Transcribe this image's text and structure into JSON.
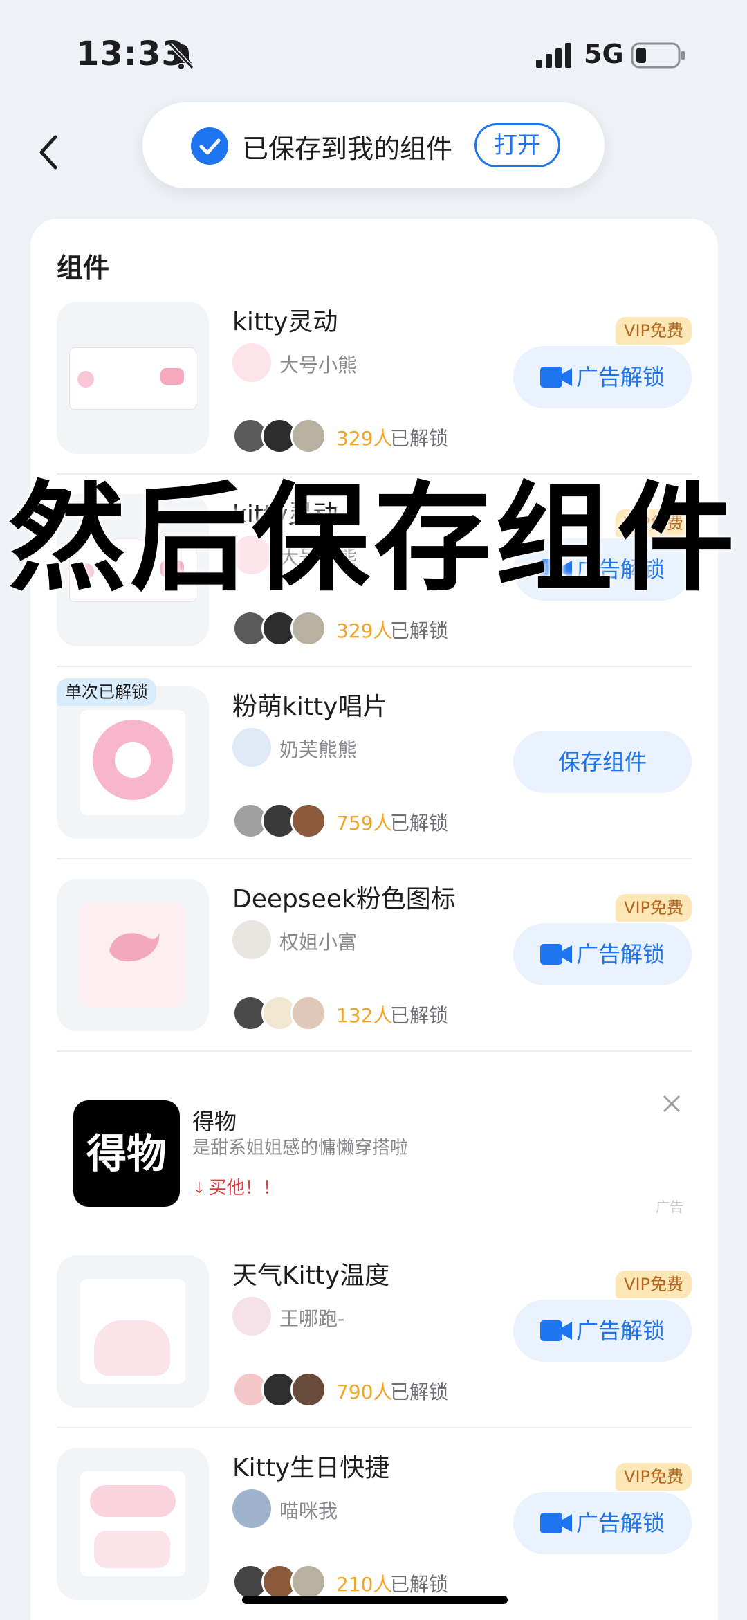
{
  "status_bar": {
    "time": "13:33",
    "network": "5G"
  },
  "toast": {
    "message": "已保存到我的组件",
    "open_label": "打开"
  },
  "section": {
    "title": "组件"
  },
  "items": [
    {
      "title": "kitty灵动",
      "author": "大号小熊",
      "count": "329人",
      "unlocked_suffix": "已解锁",
      "badge": "VIP免费",
      "action": "广告解锁"
    },
    {
      "title": "kitty灵动",
      "author": "大号小熊",
      "count": "329人",
      "unlocked_suffix": "已解锁",
      "badge": "VIP免费",
      "action": "广告解锁"
    },
    {
      "title": "粉萌kitty唱片",
      "author": "奶芙熊熊",
      "count": "759人",
      "unlocked_suffix": "已解锁",
      "corner_badge": "单次已解锁",
      "action": "保存组件"
    },
    {
      "title": "Deepseek粉色图标",
      "author": "权姐小富",
      "count": "132人",
      "unlocked_suffix": "已解锁",
      "badge": "VIP免费",
      "action": "广告解锁"
    },
    {
      "title": "天气Kitty温度",
      "author": "王哪跑-",
      "count": "790人",
      "unlocked_suffix": "已解锁",
      "badge": "VIP免费",
      "action": "广告解锁"
    },
    {
      "title": "Kitty生日快捷",
      "author": "喵咪我",
      "count": "210人",
      "unlocked_suffix": "已解锁",
      "badge": "VIP免费",
      "action": "广告解锁"
    }
  ],
  "ad": {
    "logo_text": "得物",
    "title": "得物",
    "description": "是甜系姐姐感的慵懒穿搭啦",
    "cta": "买他！！",
    "label": "广告"
  },
  "overlay": {
    "caption": "然后保存组件"
  },
  "colors": {
    "accent": "#1f74f0",
    "vip_bg": "#fde7b6",
    "count": "#f0a52a"
  }
}
